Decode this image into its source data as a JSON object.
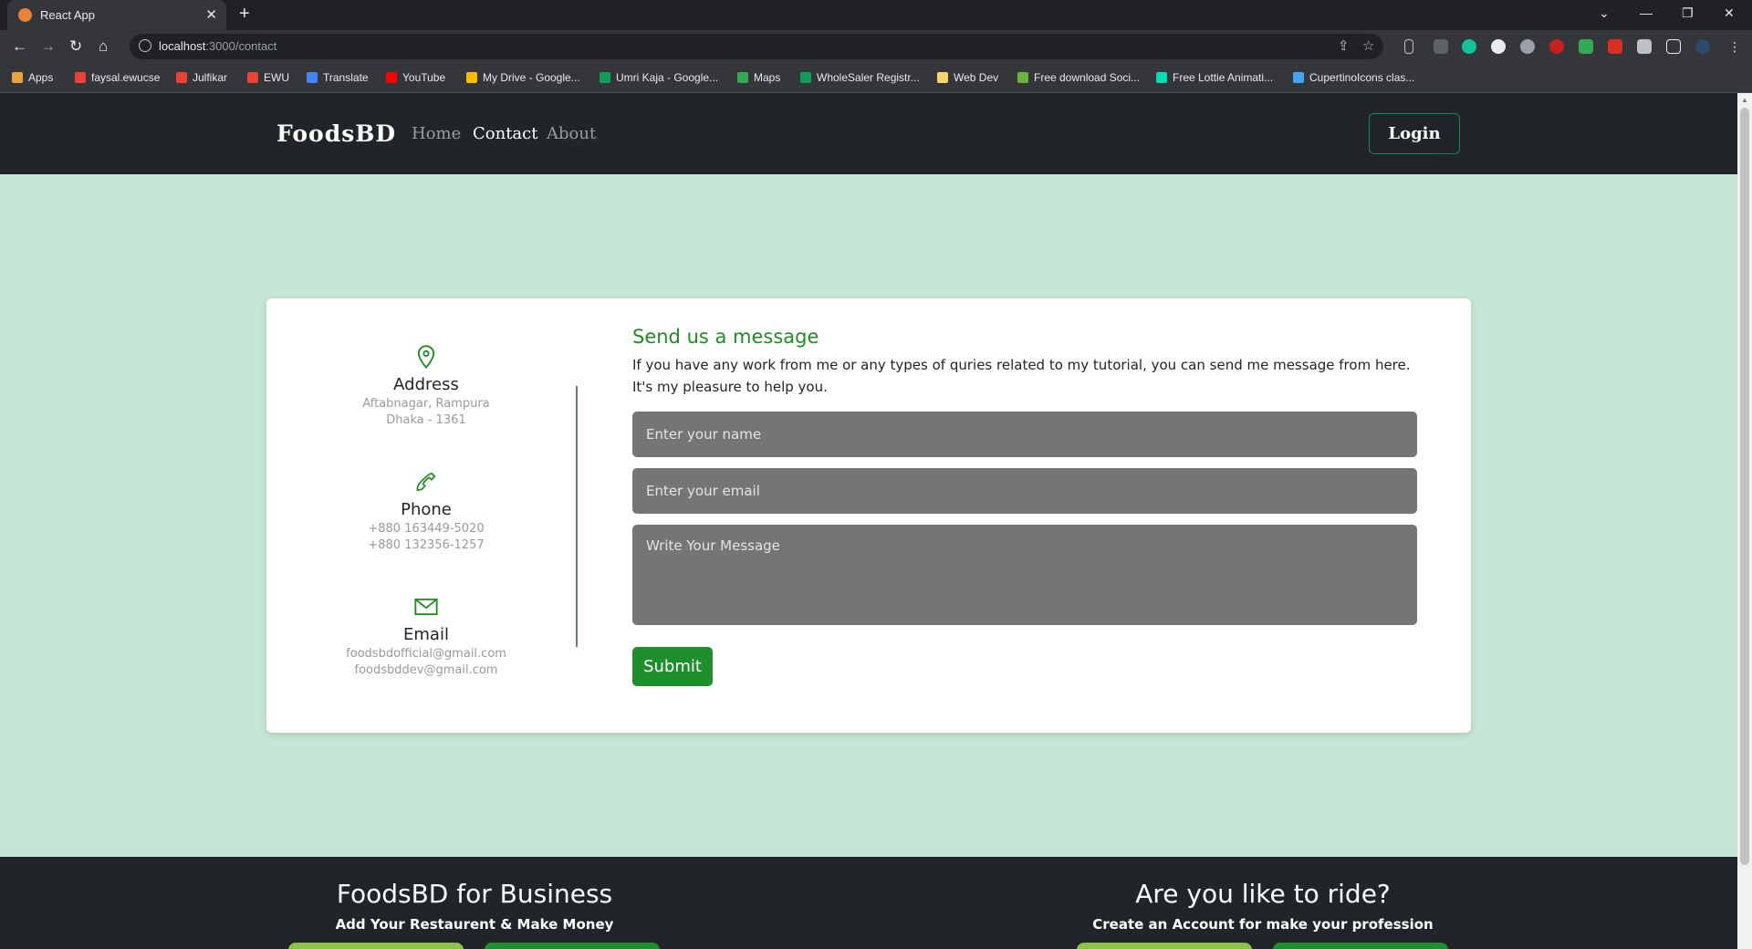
{
  "browser": {
    "tab_title": "React App",
    "tab_close": "✕",
    "new_tab": "+",
    "url_host": "localhost",
    "url_path": ":3000/contact",
    "bookmarks": [
      {
        "label": "Apps",
        "icon": "apps-grid-icon",
        "color": "#e8a33c"
      },
      {
        "label": "faysal.ewucse",
        "icon": "gmail-icon",
        "color": "#ea4335"
      },
      {
        "label": "Julfikar",
        "icon": "gmail-icon",
        "color": "#ea4335"
      },
      {
        "label": "EWU",
        "icon": "gmail-icon",
        "color": "#ea4335"
      },
      {
        "label": "Translate",
        "icon": "translate-icon",
        "color": "#4285f4"
      },
      {
        "label": "YouTube",
        "icon": "youtube-icon",
        "color": "#ff0000"
      },
      {
        "label": "My Drive - Google...",
        "icon": "drive-icon",
        "color": "#fbbc04"
      },
      {
        "label": "Umri Kaja - Google...",
        "icon": "sheets-icon",
        "color": "#0f9d58"
      },
      {
        "label": "Maps",
        "icon": "maps-icon",
        "color": "#34a853"
      },
      {
        "label": "WholeSaler Registr...",
        "icon": "sheets-icon",
        "color": "#0f9d58"
      },
      {
        "label": "Web Dev",
        "icon": "folder-icon",
        "color": "#f6d36b"
      },
      {
        "label": "Free download Soci...",
        "icon": "leaf-icon",
        "color": "#6bb33a"
      },
      {
        "label": "Free Lottie Animati...",
        "icon": "lottie-icon",
        "color": "#00ddb3"
      },
      {
        "label": "CupertinoIcons clas...",
        "icon": "flutter-icon",
        "color": "#42a5f5"
      }
    ]
  },
  "site": {
    "brand": "FoodsBD",
    "nav": [
      {
        "label": "Home",
        "active": false
      },
      {
        "label": "Contact",
        "active": true
      },
      {
        "label": "About",
        "active": false
      }
    ],
    "login_label": "Login"
  },
  "contact": {
    "address": {
      "title": "Address",
      "lines": [
        "Aftabnagar, Rampura",
        "Dhaka - 1361"
      ]
    },
    "phone": {
      "title": "Phone",
      "lines": [
        "+880 163449-5020",
        "+880 132356-1257"
      ]
    },
    "email": {
      "title": "Email",
      "lines": [
        "foodsbdofficial@gmail.com",
        "foodsbddev@gmail.com"
      ]
    }
  },
  "form": {
    "title": "Send us a message",
    "description": "If you have any work from me or any types of quries related to my tutorial, you can send me message from here. It's my pleasure to help you.",
    "name_placeholder": "Enter your name",
    "email_placeholder": "Enter your email",
    "message_placeholder": "Write Your Message",
    "submit_label": "Submit"
  },
  "footer": {
    "business": {
      "title": "FoodsBD for Business",
      "subtitle": "Add Your Restaurent & Make Money"
    },
    "ride": {
      "title": "Are you like to ride?",
      "subtitle": "Create an Account for make your profession"
    }
  },
  "colors": {
    "page_bg": "#c8e6d6",
    "nav_bg": "#212529",
    "accent_green": "#228b22",
    "submit_green": "#1f8f2e",
    "input_bg": "#757575",
    "footer_lime": "#8bc34a",
    "footer_green": "#1f8f2e"
  }
}
